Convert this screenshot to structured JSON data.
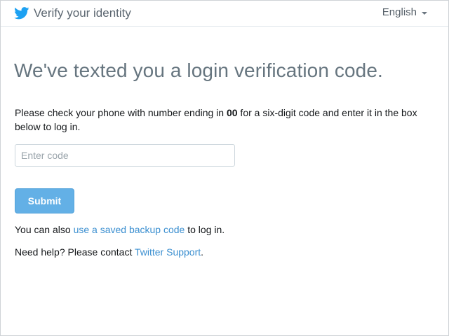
{
  "header": {
    "title": "Verify your identity",
    "language": "English",
    "logo_icon": "twitter-bird-icon",
    "dropdown_icon": "caret-down-icon"
  },
  "main": {
    "heading": "We've texted you a login verification code.",
    "instructions": {
      "before": "Please check your phone with number ending in ",
      "digits": "00",
      "after": " for a six-digit code and enter it in the box below to log in."
    },
    "code_input": {
      "placeholder": "Enter code",
      "value": ""
    },
    "submit_label": "Submit",
    "backup": {
      "before": "You can also ",
      "link": "use a saved backup code",
      "after": " to log in."
    },
    "help": {
      "before": "Need help? Please contact ",
      "link": "Twitter Support",
      "after": "."
    }
  },
  "colors": {
    "brand": "#1da1f2",
    "button": "#63b0e6",
    "link": "#3b8fd0"
  }
}
